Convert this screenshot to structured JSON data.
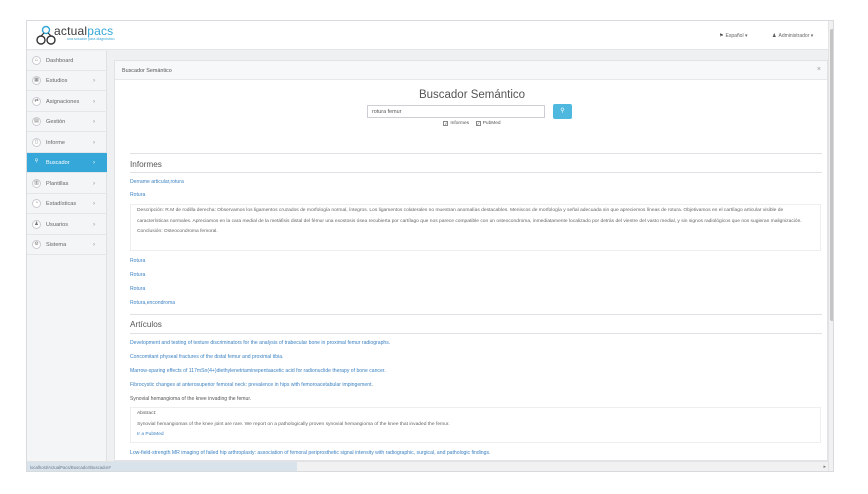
{
  "header": {
    "logo_text_prefix": "actual",
    "logo_text_accent": "pacs",
    "logo_tagline": "una solución para diagnóstico",
    "language_menu": "Español ▾",
    "user_menu": "Administrador ▾",
    "icons": {
      "language": "flag-icon",
      "user": "user-icon"
    }
  },
  "sidebar": {
    "items": [
      {
        "label": "Dashboard",
        "icon": "home-icon",
        "glyph": "⌂",
        "chevron": ""
      },
      {
        "label": "Estudios",
        "icon": "grid-icon",
        "glyph": "▦",
        "chevron": "›"
      },
      {
        "label": "Asignaciones",
        "icon": "shuffle-icon",
        "glyph": "⇄",
        "chevron": "›"
      },
      {
        "label": "Gestión",
        "icon": "calendar-icon",
        "glyph": "▤",
        "chevron": "›"
      },
      {
        "label": "Informe",
        "icon": "document-icon",
        "glyph": "▯",
        "chevron": "›"
      },
      {
        "label": "Buscador",
        "icon": "search-icon",
        "glyph": "⚲",
        "chevron": "›",
        "active": true
      },
      {
        "label": "Plantillas",
        "icon": "book-icon",
        "glyph": "▥",
        "chevron": "›"
      },
      {
        "label": "Estadísticas",
        "icon": "chart-icon",
        "glyph": "◔",
        "chevron": "›"
      },
      {
        "label": "Usuarios",
        "icon": "users-icon",
        "glyph": "♟",
        "chevron": "›"
      },
      {
        "label": "Sistema",
        "icon": "gear-icon",
        "glyph": "⚙",
        "chevron": "›"
      }
    ]
  },
  "panel": {
    "title": "Buscador Semántico",
    "close": "×",
    "search": {
      "heading": "Buscador Semántico",
      "value": "rotura femur",
      "button_icon": "search-icon",
      "button_glyph": "⚲",
      "filters": [
        {
          "label": "Informes",
          "checked": true
        },
        {
          "label": "PubMed",
          "checked": true
        }
      ]
    },
    "informes": {
      "title": "Informes",
      "results": [
        "Derrame articular,rotura",
        "Rotura",
        "Rotura",
        "Rotura",
        "Rotura",
        "Rotura,encondroma"
      ],
      "expanded": {
        "description": "Descripción: R.M de rodilla derecha: Observamos los ligamentos cruzados de morfología normal, íntegros. Los ligamentos colaterales no muestran anomalías destacables. Meniscos de morfología y señal adecuada sin que apreciemos líneas de rotura. Objetivamos en el cartílago articular visible de características normales. Apreciamos en la cara medial de la metáfisis distal del fémur una exostosis ósea recubierta por cartílago que nos parece compatible con un osteocondroma, inmediatamente localizado por detrás del vientre del vasto medial, y sin signos radiológicos que nos sugieran malignización.",
        "conclusion": "Conclusión: Osteocondroma femoral."
      }
    },
    "articulos": {
      "title": "Artículos",
      "results": [
        "Development and testing of texture discriminators for the analysis of trabecular bone in proximal femur radiographs.",
        "Concomitant physeal fractures of the distal femur and proximal tibia.",
        "Marrow-sparing effects of 117mSn(4+)diethylenetriaminepentaacetic acid for radionuclide therapy of bone cancer.",
        "Fibrocystic changes at anterosuperior femoral neck: prevalence in hips with femoroacetabular impingement.",
        "Synovial hemangioma of the knee invading the femur.",
        "Low-field-strength MR imaging of failed hip arthroplasty: association of femoral periprosthetic signal intensity with radiographic, surgical, and pathologic findings."
      ],
      "expanded": {
        "abstract_heading": "Abstract:",
        "abstract_text": "Synovial hemangiomas of the knee joint are rare. We report on a pathologically proven synovial hemangioma of the knee that invaded the femur.",
        "pubmed_link": "Ir a PubMed"
      }
    }
  },
  "status_bar": {
    "url": "localhost/ActualPacs/Buscador/Buscador#"
  },
  "colors": {
    "accent": "#35a7d8",
    "link": "#3d82c2",
    "background": "#eef0f2"
  }
}
